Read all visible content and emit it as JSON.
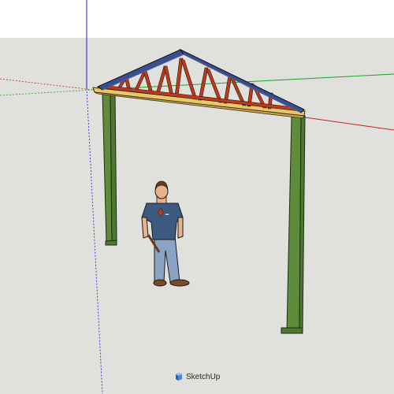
{
  "app": {
    "name": "SketchUp"
  },
  "colors": {
    "sky": "#ffffff",
    "ground": "#e0e0dc",
    "axis_red": "#cc1f1f",
    "axis_green": "#1fa51f",
    "axis_blue": "#1f1fcc",
    "truss_top_chord": "#3a4f8f",
    "truss_web": "#c0391b",
    "beam": "#e8c66a",
    "post": "#5e8c3a",
    "shirt": "#3d5a80",
    "jeans": "#8aa3c4",
    "skin": "#e8b38a",
    "hair": "#6a3a1e"
  },
  "icons": {
    "watermark_logo": "sketchup-logo-icon"
  }
}
